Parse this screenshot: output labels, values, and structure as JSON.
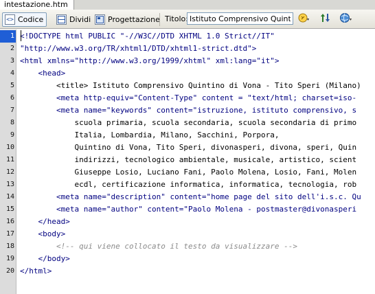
{
  "document_tab": {
    "label": "intestazione.htm"
  },
  "toolbar": {
    "code_label": "Codice",
    "split_label": "Dividi",
    "design_label": "Progettazione",
    "title_label": "Titolo:",
    "title_value": "Istituto Comprensivo Quintino"
  },
  "colors": {
    "tag": "#000080",
    "attribute": "#000080",
    "value": "#000000",
    "text": "#000000",
    "comment": "#8a8a8a",
    "gutter": "#dcdcdc",
    "current_line": "#1f5ed6"
  },
  "icons": [
    "code-view-icon",
    "split-view-icon",
    "design-view-icon",
    "browser-compatibility-icon",
    "file-transfer-icon",
    "preview-globe-icon"
  ],
  "editor": {
    "current_line": 1,
    "lines": [
      {
        "num": "1",
        "text": "<!DOCTYPE html PUBLIC \"-//W3C//DTD XHTML 1.0 Strict//IT\"",
        "kind": "tag"
      },
      {
        "num": "2",
        "text": "\"http://www.w3.org/TR/xhtml1/DTD/xhtml1-strict.dtd\">",
        "kind": "tag"
      },
      {
        "num": "3",
        "text": "<html xmlns=\"http://www.w3.org/1999/xhtml\" xml:lang=\"it\">",
        "kind": "tag"
      },
      {
        "num": "4",
        "text": "    <head>",
        "kind": "tag"
      },
      {
        "num": "5",
        "text": "        <title> Istituto Comprensivo Quintino di Vona - Tito Speri (Milano)",
        "kind": "text"
      },
      {
        "num": "6",
        "text": "        <meta http-equiv=\"Content-Type\" content = \"text/html; charset=iso-",
        "kind": "tag"
      },
      {
        "num": "7",
        "text": "        <meta name=\"keywords\" content=\"istruzione, istituto comprensivo, s",
        "kind": "tag"
      },
      {
        "num": "8",
        "text": "            scuola primaria, scuola secondaria, scuola secondaria di primo",
        "kind": "text"
      },
      {
        "num": "9",
        "text": "            Italia, Lombardia, Milano, Sacchini, Porpora,",
        "kind": "text"
      },
      {
        "num": "10",
        "text": "            Quintino di Vona, Tito Speri, divonasperi, divona, speri, Quin",
        "kind": "text"
      },
      {
        "num": "11",
        "text": "            indirizzi, tecnologico ambientale, musicale, artistico, scient",
        "kind": "text"
      },
      {
        "num": "12",
        "text": "            Giuseppe Losio, Luciano Fani, Paolo Molena, Losio, Fani, Molen",
        "kind": "text"
      },
      {
        "num": "13",
        "text": "            ecdl, certificazione informatica, informatica, tecnologia, rob",
        "kind": "text"
      },
      {
        "num": "14",
        "text": "        <meta name=\"description\" content=\"home page del sito dell'i.s.c. Qu",
        "kind": "tag"
      },
      {
        "num": "15",
        "text": "        <meta name=\"author\" content=\"Paolo Molena - postmaster@divonasperi",
        "kind": "tag"
      },
      {
        "num": "16",
        "text": "    </head>",
        "kind": "tag"
      },
      {
        "num": "17",
        "text": "    <body>",
        "kind": "tag"
      },
      {
        "num": "18",
        "text": "        <!-- qui viene collocato il testo da visualizzare -->",
        "kind": "comment"
      },
      {
        "num": "19",
        "text": "    </body>",
        "kind": "tag"
      },
      {
        "num": "20",
        "text": "</html>",
        "kind": "tag"
      }
    ]
  }
}
